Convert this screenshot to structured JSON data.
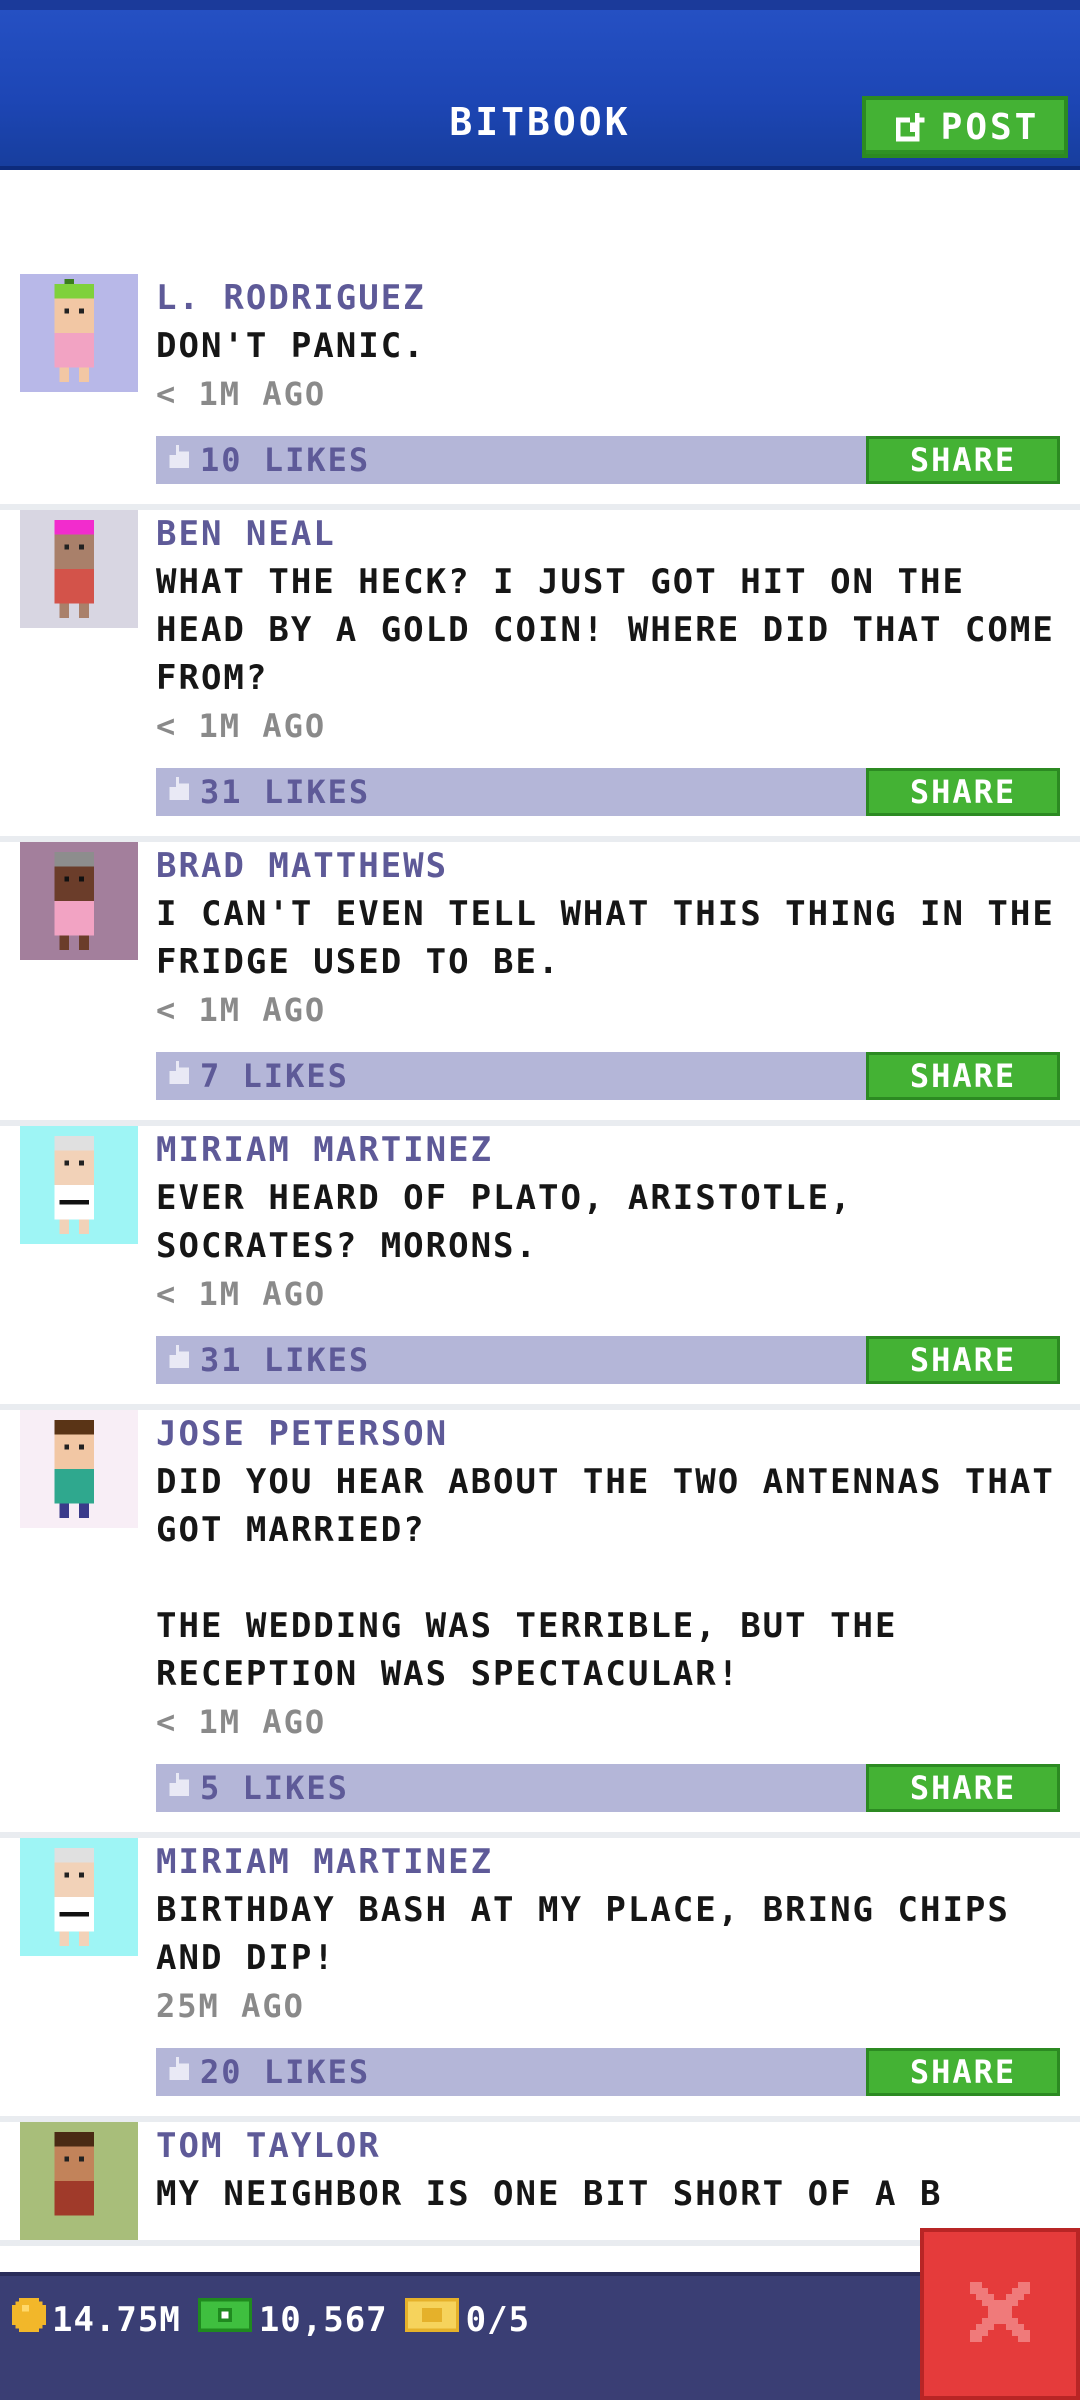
{
  "header": {
    "title": "BITBOOK",
    "post_label": "POST"
  },
  "feed": {
    "posts": [
      {
        "author": "L. RODRIGUEZ",
        "message": "DON'T PANIC.",
        "time": "< 1M AGO",
        "likes": "10 LIKES",
        "share": "SHARE",
        "avatar_bg": "#b8b8e8"
      },
      {
        "author": "BEN NEAL",
        "message": "WHAT THE HECK? I JUST GOT HIT ON THE HEAD BY A GOLD COIN! WHERE DID THAT COME FROM?",
        "time": "< 1M AGO",
        "likes": "31 LIKES",
        "share": "SHARE",
        "avatar_bg": "#d8d6e2"
      },
      {
        "author": "BRAD MATTHEWS",
        "message": "I CAN'T EVEN TELL WHAT THIS THING IN THE FRIDGE USED TO BE.",
        "time": "< 1M AGO",
        "likes": "7 LIKES",
        "share": "SHARE",
        "avatar_bg": "#a37f9c"
      },
      {
        "author": "MIRIAM MARTINEZ",
        "message": "EVER HEARD OF PLATO, ARISTOTLE, SOCRATES? MORONS.",
        "time": "< 1M AGO",
        "likes": "31 LIKES",
        "share": "SHARE",
        "avatar_bg": "#9ef5f5"
      },
      {
        "author": "JOSE PETERSON",
        "message": "DID YOU HEAR ABOUT THE TWO ANTENNAS THAT GOT MARRIED?\n\nTHE WEDDING WAS TERRIBLE, BUT THE RECEPTION WAS SPECTACULAR!",
        "time": "< 1M AGO",
        "likes": "5 LIKES",
        "share": "SHARE",
        "avatar_bg": "#f8eef6"
      },
      {
        "author": "MIRIAM MARTINEZ",
        "message": "BIRTHDAY BASH AT MY PLACE, BRING CHIPS AND DIP!",
        "time": "25M AGO",
        "likes": "20 LIKES",
        "share": "SHARE",
        "avatar_bg": "#9ef5f5"
      },
      {
        "author": "TOM TAYLOR",
        "message": "MY NEIGHBOR IS ONE BIT SHORT OF A B",
        "time": "",
        "likes": "",
        "share": "",
        "avatar_bg": "#a8be7a"
      }
    ]
  },
  "bottom": {
    "coins": "14.75M",
    "bux": "10,567",
    "tickets": "0/5"
  },
  "colors": {
    "header_blue": "#1d46b5",
    "share_green": "#44b234",
    "likes_bar": "#b4b6d8",
    "author_purple": "#5e5a98",
    "close_red": "#e53b3b"
  }
}
